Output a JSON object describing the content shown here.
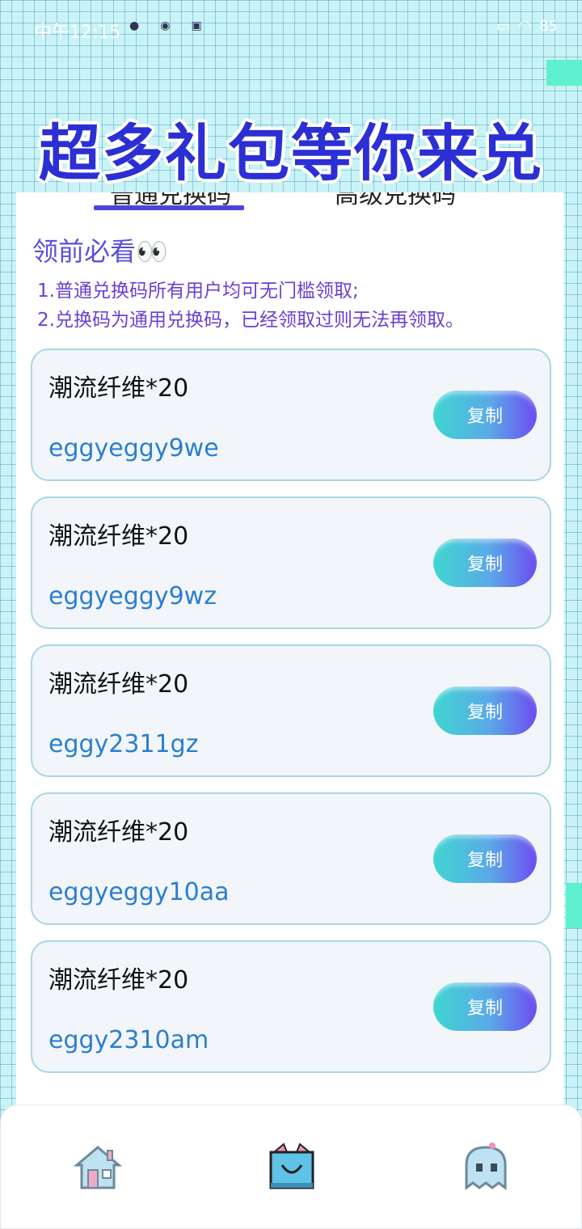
{
  "status_bar": {
    "time": "中午12:15",
    "battery": "85"
  },
  "banner": {
    "title": "超多礼包等你来兑"
  },
  "tabs": [
    {
      "label": "普通兑换码"
    },
    {
      "label": "高级兑换码"
    }
  ],
  "notice": {
    "title": "领前必看👀",
    "lines": [
      "1.普通兑换码所有用户均可无门槛领取;",
      "2.兑换码为通用兑换码，已经领取过则无法再领取。"
    ]
  },
  "codes": [
    {
      "name": "潮流纤维*20",
      "code": "eggyeggy9we",
      "button": "复制"
    },
    {
      "name": "潮流纤维*20",
      "code": "eggyeggy9wz",
      "button": "复制"
    },
    {
      "name": "潮流纤维*20",
      "code": "eggy2311gz",
      "button": "复制"
    },
    {
      "name": "潮流纤维*20",
      "code": "eggyeggy10aa",
      "button": "复制"
    },
    {
      "name": "潮流纤维*20",
      "code": "eggy2310am",
      "button": "复制"
    }
  ],
  "bottom_nav": [
    {
      "icon": "home-icon"
    },
    {
      "icon": "shopping-bag-icon"
    },
    {
      "icon": "ghost-icon"
    }
  ],
  "colors": {
    "accent": "#4d44e0",
    "code_text": "#2b7fcf",
    "notice_text": "#6b3fd6"
  }
}
